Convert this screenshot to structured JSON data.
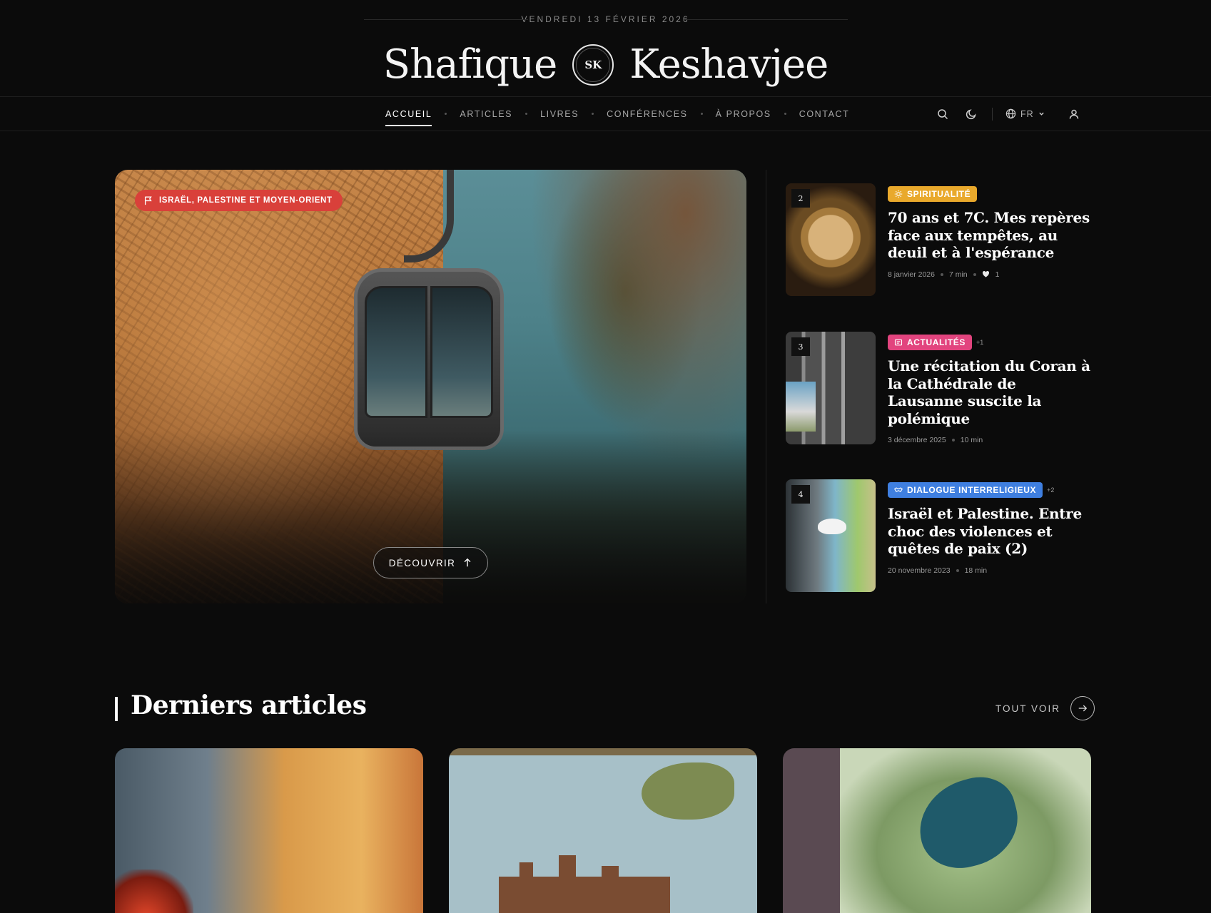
{
  "header": {
    "date": "VENDREDI 13 FÉVRIER 2026",
    "brand_first": "Shafique",
    "brand_logo": "SK",
    "brand_last": "Keshavjee"
  },
  "nav": {
    "items": [
      {
        "label": "ACCUEIL",
        "active": true
      },
      {
        "label": "ARTICLES"
      },
      {
        "label": "LIVRES"
      },
      {
        "label": "CONFÉRENCES"
      },
      {
        "label": "À PROPOS"
      },
      {
        "label": "CONTACT"
      }
    ],
    "tools": {
      "search_icon": "search-icon",
      "theme_icon": "moon-icon",
      "language": "FR",
      "user_icon": "user-icon"
    }
  },
  "hero": {
    "badge": "ISRAËL, PALESTINE ET MOYEN-ORIENT",
    "badge_color": "#d9403a",
    "cta": "DÉCOUVRIR"
  },
  "side_articles": [
    {
      "number": "2",
      "category": "SPIRITUALITÉ",
      "category_color": "#e9a92c",
      "extra": "",
      "title": "70 ans et 7C. Mes repères face aux tempêtes, au deuil et à l'espérance",
      "date": "8 janvier 2026",
      "read_time": "7 min",
      "likes": "1"
    },
    {
      "number": "3",
      "category": "ACTUALITÉS",
      "category_color": "#e2447e",
      "extra": "+1",
      "title": "Une récitation du Coran à la Cathédrale de Lausanne suscite la polémique",
      "date": "3 décembre 2025",
      "read_time": "10 min"
    },
    {
      "number": "4",
      "category": "DIALOGUE INTERRELIGIEUX",
      "category_color": "#3f7fe0",
      "extra": "+2",
      "title": "Israël et Palestine. Entre choc des violences et quêtes de paix (2)",
      "date": "20 novembre 2023",
      "read_time": "18 min"
    }
  ],
  "latest": {
    "title": "Derniers articles",
    "see_all": "TOUT VOIR"
  }
}
